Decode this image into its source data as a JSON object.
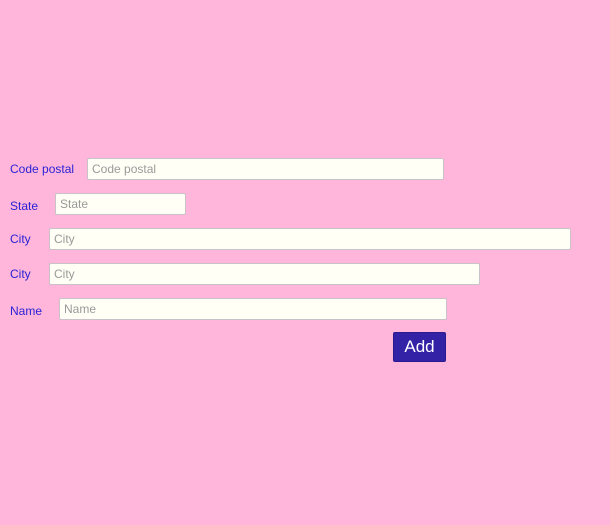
{
  "form": {
    "fields": [
      {
        "label": "Code postal",
        "placeholder": "Code postal",
        "value": ""
      },
      {
        "label": "State",
        "placeholder": "State",
        "value": ""
      },
      {
        "label": "City",
        "placeholder": "City",
        "value": ""
      },
      {
        "label": "City",
        "placeholder": "City",
        "value": ""
      },
      {
        "label": "Name",
        "placeholder": "Name",
        "value": ""
      }
    ],
    "submit_label": "Add"
  },
  "colors": {
    "background": "#ffb6da",
    "label": "#2a22d6",
    "button": "#3422a6",
    "input_background": "#fffff5"
  }
}
